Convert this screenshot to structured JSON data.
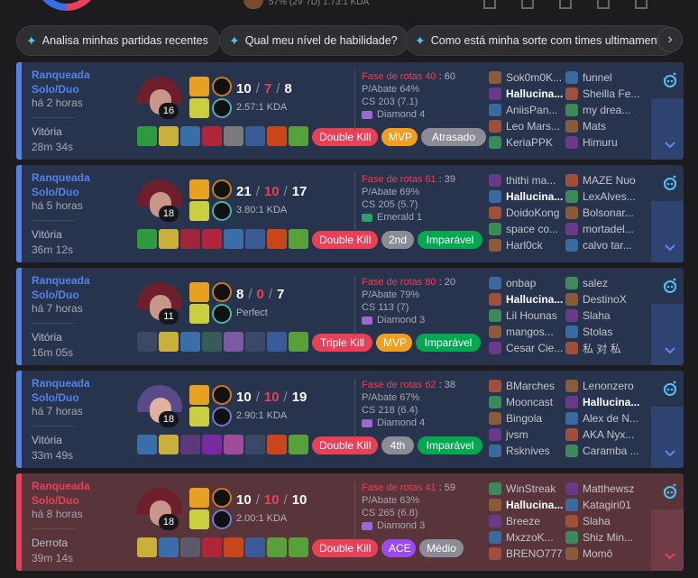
{
  "top": {
    "partial_text": "57% (2V 7D)   1.73:1 KDA"
  },
  "chips": [
    {
      "label": "Analisa minhas partidas recentes"
    },
    {
      "label": "Qual meu nível de habilidade?"
    },
    {
      "label": "Como está minha sorte com times ultimamente"
    }
  ],
  "colors": {
    "win_accent": "#5383e8",
    "loss_accent": "#e84057",
    "win_bg": "#28344e",
    "loss_bg": "#59343b",
    "badge_red": "#e84057",
    "badge_gold": "#f0a020",
    "badge_gray": "#8c8c96",
    "badge_green": "#00a850",
    "badge_purple": "#9c4af0"
  },
  "matches": [
    {
      "result": "win",
      "queue": "Ranqueada Solo/Duo",
      "time_ago": "há 2 horas",
      "outcome": "Vitória",
      "duration": "28m 34s",
      "level": "16",
      "kills": "10",
      "deaths": "7",
      "assists": "8",
      "kda_ratio": "2.57:1 KDA",
      "lane_label": "Fase de rotas 40",
      "lane_rest": " : 60",
      "kill_participation": "P/Abate 64%",
      "cs": "CS 203 (7.1)",
      "rank": "Diamond 4",
      "badges": [
        "Double Kill",
        "MVP",
        "Atrasado"
      ],
      "team1": [
        "Sok0m0K...",
        "Hallucina...",
        "AniisPan...",
        "Leo Mars...",
        "KeriaPPK"
      ],
      "team2": [
        "funnel",
        "Sheilla Fe...",
        "my drea...",
        "Mats",
        "Himuru"
      ]
    },
    {
      "result": "win",
      "queue": "Ranqueada Solo/Duo",
      "time_ago": "há 5 horas",
      "outcome": "Vitória",
      "duration": "36m 12s",
      "level": "18",
      "kills": "21",
      "deaths": "10",
      "assists": "17",
      "kda_ratio": "3.80:1 KDA",
      "lane_label": "Fase de rotas 61",
      "lane_rest": " : 39",
      "kill_participation": "P/Abate 69%",
      "cs": "CS 205 (5.7)",
      "rank": "Emerald 1",
      "badges": [
        "Double Kill",
        "2nd",
        "Imparável"
      ],
      "team1": [
        "thithi ma...",
        "Hallucina...",
        "DoidoKong",
        "space co...",
        "Harl0ck"
      ],
      "team2": [
        "MAZE Nuo",
        "LexAlves...",
        "Bolsonar...",
        "mortadel...",
        "calvo tar..."
      ]
    },
    {
      "result": "win",
      "queue": "Ranqueada Solo/Duo",
      "time_ago": "há 7 horas",
      "outcome": "Vitória",
      "duration": "16m 05s",
      "level": "11",
      "kills": "8",
      "deaths": "0",
      "assists": "7",
      "kda_ratio": "Perfect",
      "lane_label": "Fase de rotas 80",
      "lane_rest": " : 20",
      "kill_participation": "P/Abate 79%",
      "cs": "CS 113 (7)",
      "rank": "Diamond 3",
      "badges": [
        "Triple Kill",
        "MVP",
        "Imparável"
      ],
      "team1": [
        "onbap",
        "Hallucina...",
        "Lil Hounas",
        "mangos...",
        "Cesar Cie..."
      ],
      "team2": [
        "salez",
        "DestinoX",
        "Slaha",
        "Stolas",
        "私 对 私"
      ]
    },
    {
      "result": "win",
      "queue": "Ranqueada Solo/Duo",
      "time_ago": "há 7 horas",
      "outcome": "Vitória",
      "duration": "33m 49s",
      "level": "18",
      "kills": "10",
      "deaths": "10",
      "assists": "19",
      "kda_ratio": "2.90:1 KDA",
      "lane_label": "Fase de rotas 62",
      "lane_rest": " : 38",
      "kill_participation": "P/Abate 67%",
      "cs": "CS 218 (6.4)",
      "rank": "Diamond 4",
      "badges": [
        "Double Kill",
        "4th",
        "Imparável"
      ],
      "team1": [
        "BMarches",
        "Mooncast",
        "Bingola",
        "jvsm",
        "Rsknives"
      ],
      "team2": [
        "Lenonzero",
        "Hallucina...",
        "Alex de N...",
        "AKA Nyx...",
        "Caramba ..."
      ]
    },
    {
      "result": "loss",
      "queue": "Ranqueada Solo/Duo",
      "time_ago": "há 8 horas",
      "outcome": "Derrota",
      "duration": "39m 14s",
      "level": "18",
      "kills": "10",
      "deaths": "10",
      "assists": "10",
      "kda_ratio": "2.00:1 KDA",
      "lane_label": "Fase de rotas 41",
      "lane_rest": " : 59",
      "kill_participation": "P/Abate 63%",
      "cs": "CS 265 (6.8)",
      "rank": "Diamond 3",
      "badges": [
        "Double Kill",
        "ACE",
        "Médio"
      ],
      "team1": [
        "WinStreak",
        "Hallucina...",
        "Breeze",
        "MxzzoK...",
        "BRENO777"
      ],
      "team2": [
        "Matthewsz",
        "Katagiri01",
        "Slaha",
        "Shiz Min...",
        "Momô"
      ]
    }
  ]
}
